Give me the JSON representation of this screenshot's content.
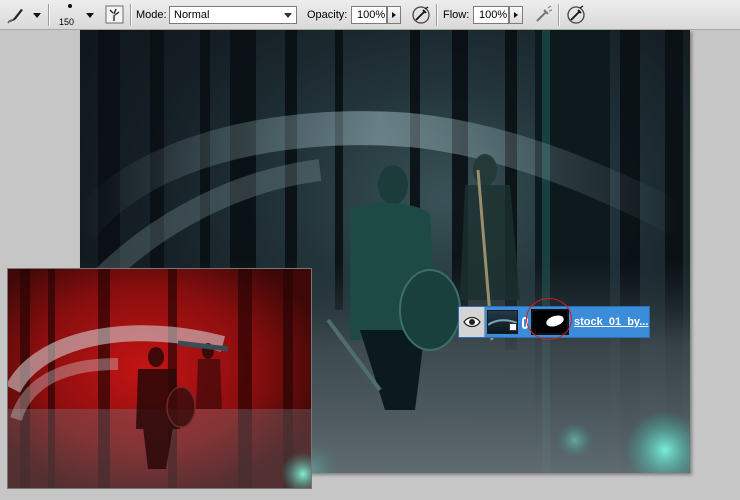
{
  "toolbar": {
    "brush_size": "150",
    "mode_label": "Mode:",
    "mode_value": "Normal",
    "opacity_label": "Opacity:",
    "opacity_value": "100%",
    "flow_label": "Flow:",
    "flow_value": "100%"
  },
  "layer": {
    "name": "stock_01_by...",
    "visible": true,
    "mask_selected": true
  },
  "icons": {
    "brush_tool": "brush-icon",
    "brush_panel": "brush-panel-toggle-icon",
    "opacity_pressure": "airbrush-icon",
    "flow_airbrush": "airbrush-disabled-icon",
    "tablet_pressure": "tablet-pressure-icon",
    "eye": "eye-icon",
    "smart_object": "smart-object-icon",
    "link": "chain-link-icon"
  },
  "colors": {
    "quick_mask": "#b01010",
    "layer_highlight": "#3b8cd9",
    "annotation_circle": "#d02020"
  }
}
